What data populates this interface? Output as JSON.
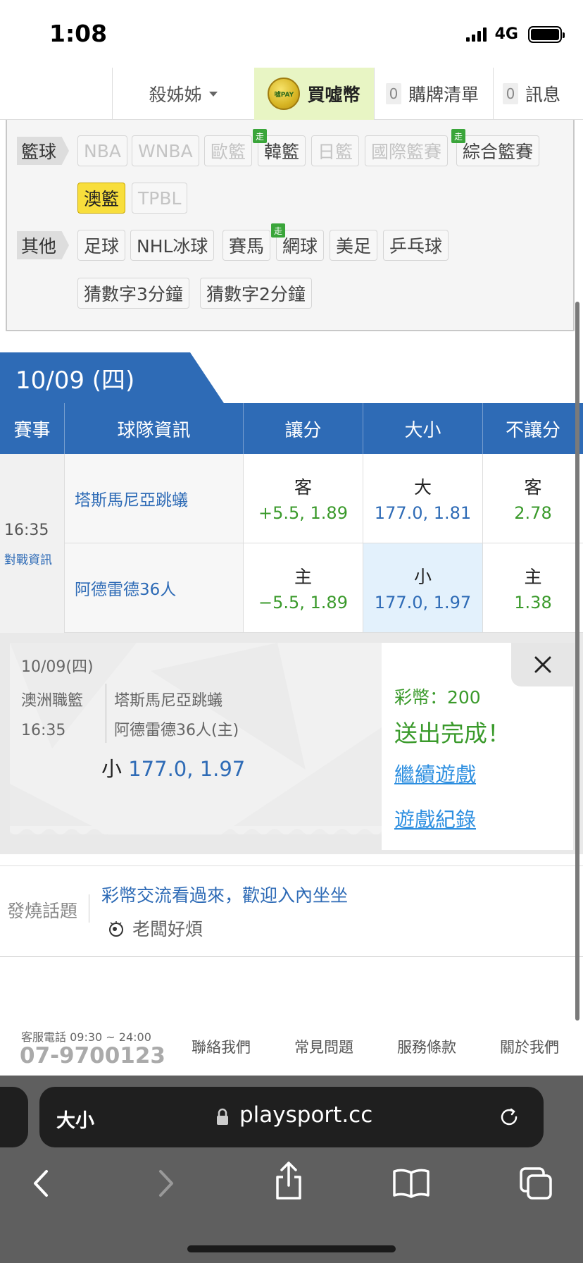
{
  "status_bar": {
    "time": "1:08",
    "network": "4G"
  },
  "topnav": {
    "user": "殺姊姊",
    "buy_coin": "買噓幣",
    "coin_logo_text": "噓PAY",
    "cart_count": "0",
    "cart_label": "購牌清單",
    "msg_count": "0",
    "msg_label": "訊息"
  },
  "categories": {
    "basketball_label": "籃球",
    "basketball": [
      "NBA",
      "WNBA",
      "歐籃",
      "韓籃",
      "日籃",
      "國際籃賽",
      "綜合籃賽",
      "澳籃",
      "TPBL"
    ],
    "others_label": "其他",
    "others": [
      "足球",
      "NHL冰球",
      "賽馬",
      "網球",
      "美足",
      "乒乓球",
      "猜數字3分鐘",
      "猜數字2分鐘"
    ],
    "walk_badge": "走"
  },
  "table": {
    "date": "10/09 (四)",
    "headers": [
      "賽事",
      "球隊資訊",
      "讓分",
      "大小",
      "不讓分"
    ],
    "time": "16:35",
    "matchup_link": "對戰資訊",
    "rows": [
      {
        "team": "塔斯馬尼亞跳蟻",
        "spread_k": "客",
        "spread_v": "+5.5, 1.89",
        "total_k": "大",
        "total_v": "177.0, 1.81",
        "ml_k": "客",
        "ml_v": "2.78"
      },
      {
        "team": "阿德雷德36人",
        "spread_k": "主",
        "spread_v": "−5.5, 1.89",
        "total_k": "小",
        "total_v": "177.0, 1.97",
        "ml_k": "主",
        "ml_v": "1.38"
      }
    ]
  },
  "receipt": {
    "date": "10/09(四)",
    "league": "澳洲職籃",
    "time": "16:35",
    "away": "塔斯馬尼亞跳蟻",
    "home": "阿德雷德36人(主)",
    "pick_k": "小",
    "pick_v": "177.0, 1.97",
    "coins": "彩幣：200",
    "done": "送出完成！",
    "continue": "繼續遊戲",
    "history": "遊戲紀錄"
  },
  "hot_topic": {
    "label": "發燒話題",
    "title": "彩幣交流看過來，歡迎入內坐坐",
    "author": "老闆好煩"
  },
  "footer": {
    "service_label": "客服電話 09:30 ~ 24:00",
    "phone": "07-9700123",
    "links": [
      "聯絡我們",
      "常見問題",
      "服務條款",
      "關於我們"
    ]
  },
  "browser": {
    "text_size": "大小",
    "domain": "playsport.cc"
  }
}
